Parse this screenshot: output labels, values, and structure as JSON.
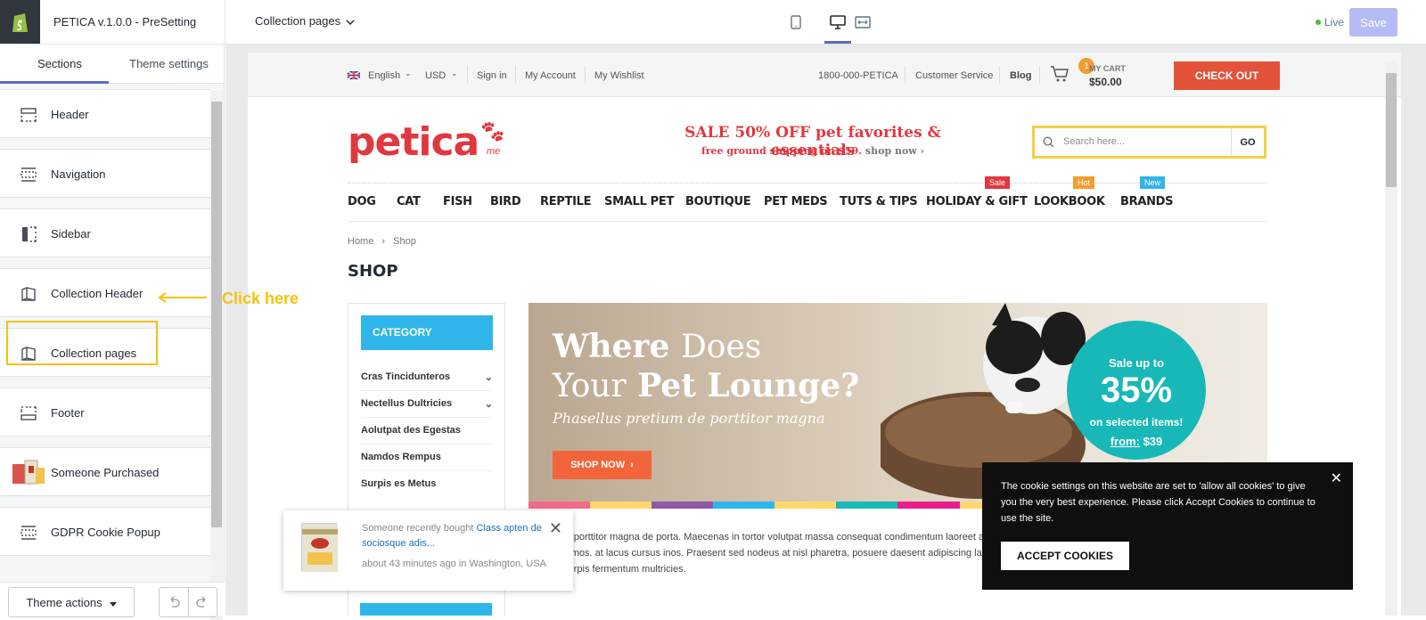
{
  "header": {
    "theme_name": "PETICA v.1.0.0 - PreSetting",
    "page_selector": "Collection pages",
    "live_label": "Live",
    "save_label": "Save"
  },
  "left_panel": {
    "tabs": [
      "Sections",
      "Theme settings"
    ],
    "sections": [
      {
        "label": "Header",
        "icon": "header-section-icon"
      },
      {
        "label": "Navigation",
        "icon": "navigation-section-icon"
      },
      {
        "label": "Sidebar",
        "icon": "sidebar-section-icon"
      },
      {
        "label": "Collection Header",
        "icon": "collection-section-icon"
      },
      {
        "label": "Collection pages",
        "icon": "collection-section-icon"
      },
      {
        "label": "Footer",
        "icon": "footer-section-icon"
      },
      {
        "label": "Someone Purchased",
        "icon": "product-thumbnail-icon"
      },
      {
        "label": "GDPR Cookie Popup",
        "icon": "section-icon"
      }
    ],
    "theme_actions_label": "Theme actions"
  },
  "annotation": {
    "click_here": "Click here"
  },
  "store": {
    "top_bar": {
      "language": "English",
      "currency": "USD",
      "sign_in": "Sign in",
      "my_account": "My Account",
      "my_wishlist": "My Wishlist",
      "phone": "1800-000-PETICA",
      "customer_service": "Customer Service",
      "blog": "Blog",
      "cart_count": "1",
      "cart_label": "MY CART",
      "cart_total": "$50.00",
      "checkout": "CHECK OUT"
    },
    "logo_text": "petica",
    "logo_suffix": "me",
    "promo_main": "SALE 50% OFF pet favorites & essentials",
    "promo_sub": "free ground shipping on $59.",
    "promo_link": "shop now",
    "search_placeholder": "Search here...",
    "search_go": "GO",
    "menu": [
      "DOG",
      "CAT",
      "FISH",
      "BIRD",
      "REPTILE",
      "SMALL PET",
      "BOUTIQUE",
      "PET MEDS",
      "TUTS & TIPS",
      "HOLIDAY & GIFT",
      "LOOKBOOK",
      "BRANDS"
    ],
    "menu_tags": {
      "sale": "Sale",
      "hot": "Hot",
      "new": "New"
    },
    "breadcrumb": {
      "home": "Home",
      "current": "Shop"
    },
    "page_title": "SHOP",
    "category_title": "CATEGORY",
    "categories": [
      "Cras Tincidunteros",
      "Nectellus Dultricies",
      "Aolutpat des Egestas",
      "Namdos Rempus",
      "Surpis es Metus"
    ],
    "banner": {
      "line1_bold": "Where",
      "line1_light": "Does",
      "line2_light": "Your",
      "line2_bold": "Pet Lounge?",
      "tagline": "Phasellus pretium de porttitor magna",
      "button": "SHOP NOW",
      "badge_top": "Sale up to",
      "badge_pct": "35%",
      "badge_mid": "on selected items!",
      "badge_from": "from:",
      "badge_price": "$39"
    },
    "body_text": "is pretium porttitor magna de porta. Maecenas in tortor volutpat massa consequat condimentum laoreet ac turpis. Ut consequat elit et enim fringilla dignissim duis dictum eros dectimos. at lacus cursus inos. Praesent sed nodeus at nisl pharetra, posuere daesent adipiscing laoreet dectimos feugiat, sed posuere mipsum tempor. esent id just sit amet turpis fermentum multricies.",
    "stripe_colors": [
      "#f26b8a",
      "#ffd86b",
      "#8e5aa8",
      "#2fb5e9",
      "#ffd86b",
      "#19b8b8",
      "#e91e8c",
      "#ffd86b",
      "#8e5aa8",
      "#2fb5e9",
      "#f26b8a",
      "#19b8b8"
    ]
  },
  "notification": {
    "prefix": "Someone recently bought",
    "product": "Class apten de sociosque adis...",
    "meta": "about 43 minutes ago in Washington, USA"
  },
  "cookie_popup": {
    "message": "The cookie settings on this website are set to 'allow all cookies' to give you the very best experience. Please click Accept Cookies to continue to use the site.",
    "accept": "ACCEPT COOKIES"
  }
}
